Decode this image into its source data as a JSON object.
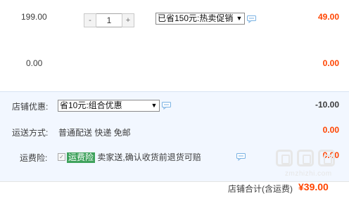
{
  "items": [
    {
      "unit_price": "199.00",
      "quantity": "1",
      "qty_minus": "-",
      "qty_plus": "+",
      "promo_select": "已省150元:热卖促销",
      "subtotal": "49.00"
    },
    {
      "unit_price": "0.00",
      "subtotal": "0.00"
    }
  ],
  "store_discount": {
    "label": "店铺优惠:",
    "select": "省10元:组合优惠",
    "amount": "-10.00"
  },
  "shipping": {
    "label": "运送方式:",
    "text": "普通配送 快递 免邮",
    "amount": "0.00"
  },
  "insurance": {
    "label": "运费险:",
    "tag": "运费险",
    "text": "卖家送,确认收货前退货可赔",
    "amount": "0.00"
  },
  "total": {
    "label": "店铺合计(含运费)",
    "amount": "¥39.00"
  },
  "watermark": "zmzhizhi.com",
  "colors": {
    "price_red": "#ff4400",
    "discount_bg": "#f2f7ff",
    "insurance_tag": "#3fa25c"
  },
  "icons": [
    "chat-bubble-icon",
    "checkbox-icon",
    "watermark-logo-icon"
  ]
}
